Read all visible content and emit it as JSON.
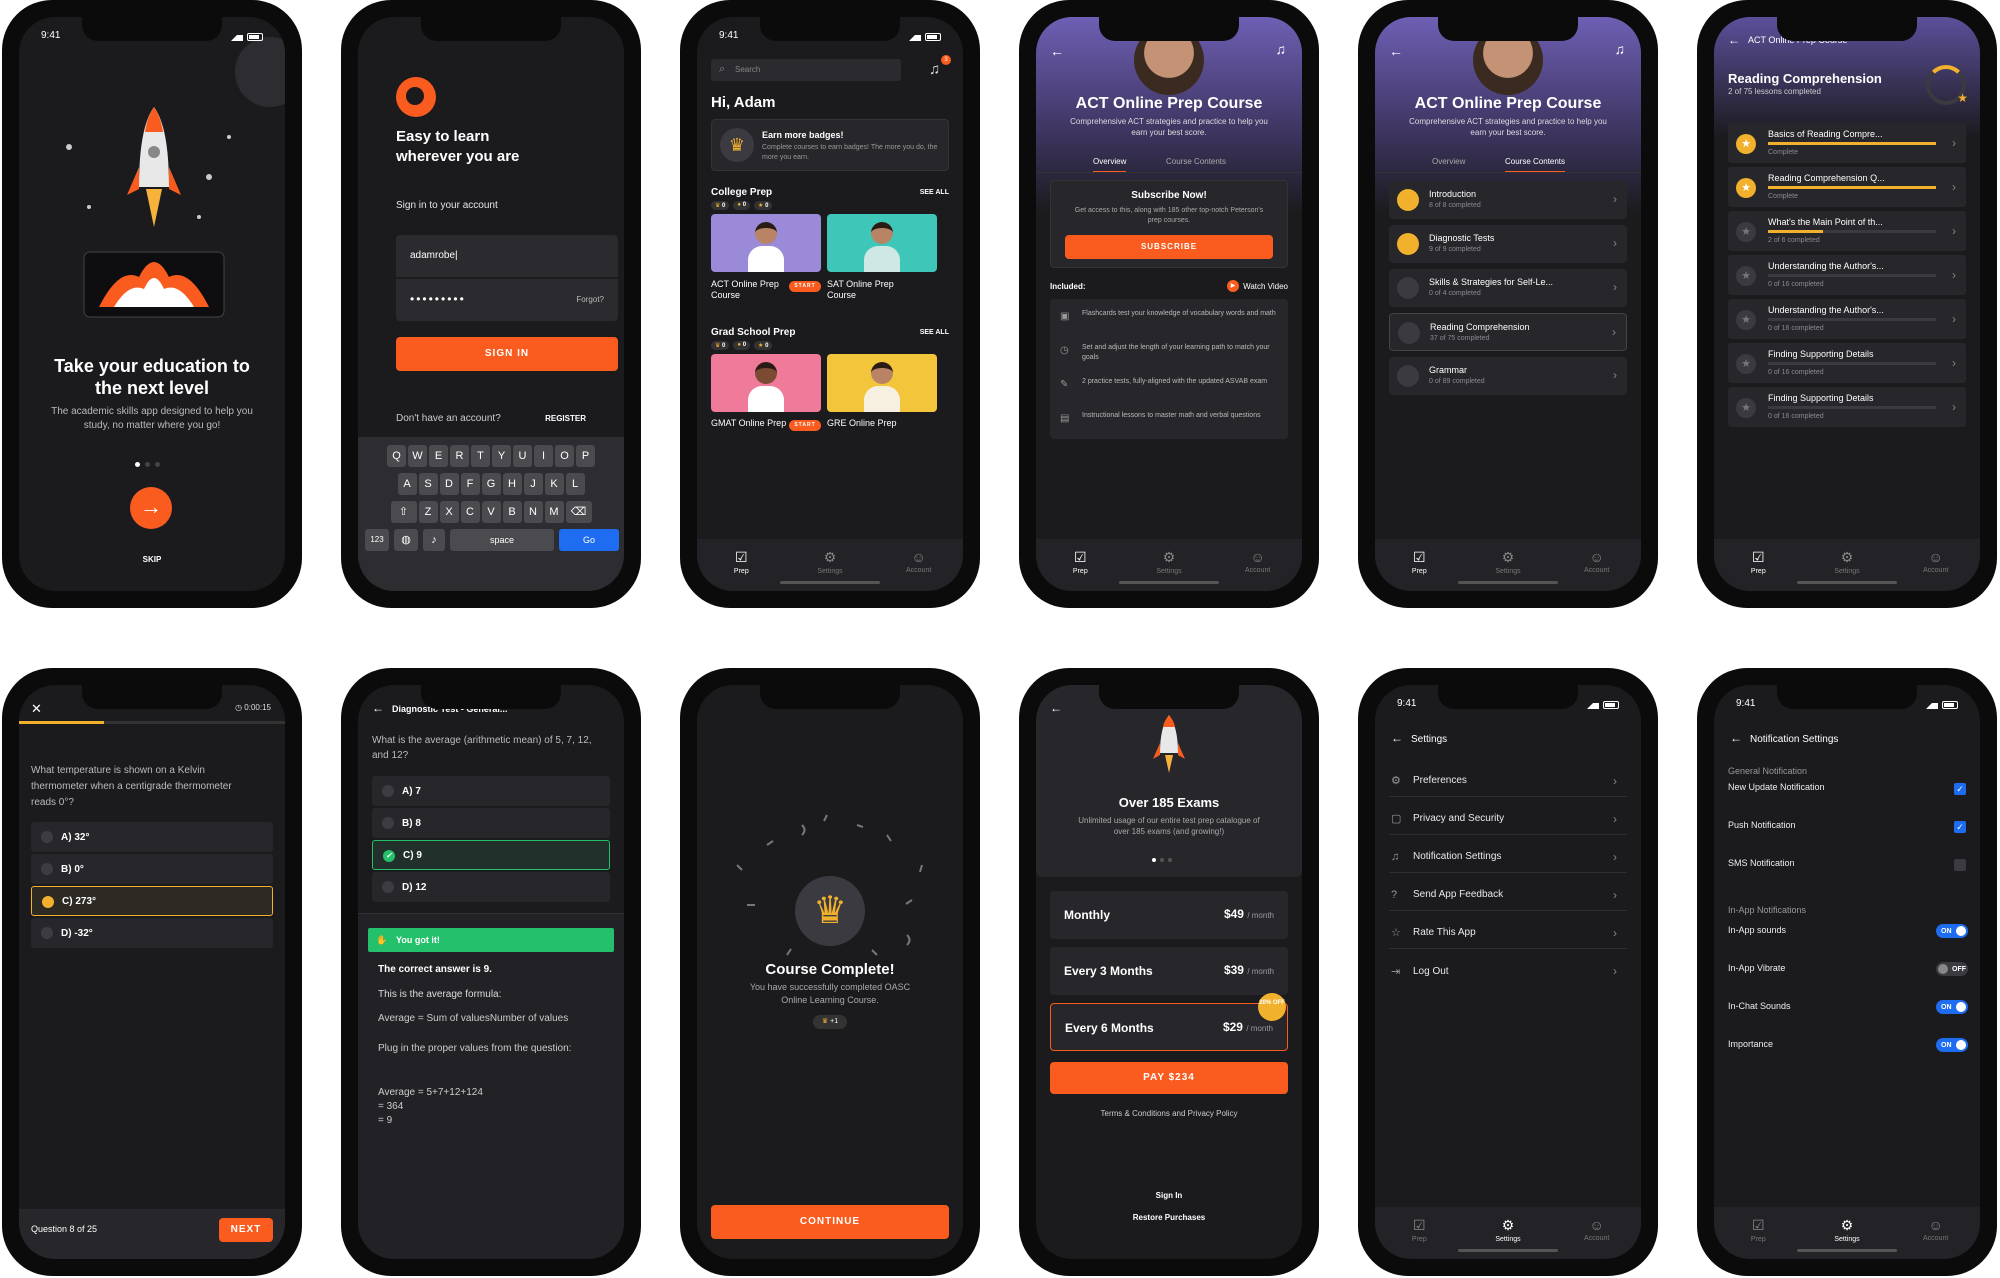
{
  "common": {
    "time": "9:41",
    "tab_prep": "Prep",
    "tab_settings": "Settings",
    "tab_account": "Account"
  },
  "s1": {
    "title": "Take your education to the next level",
    "subtitle": "The academic skills app designed to help you study, no matter where you go!",
    "skip": "SKIP"
  },
  "s2": {
    "headline": "Easy to learn wherever you are",
    "signin_prompt": "Sign in to your account",
    "username": "adamrobe|",
    "password": "•••••••••",
    "forgot": "Forgot?",
    "signin": "SIGN IN",
    "no_account": "Don't have an account?",
    "register": "REGISTER",
    "keys_row1": [
      "Q",
      "W",
      "E",
      "R",
      "T",
      "Y",
      "U",
      "I",
      "O",
      "P"
    ],
    "keys_row2": [
      "A",
      "S",
      "D",
      "F",
      "G",
      "H",
      "J",
      "K",
      "L"
    ],
    "keys_row3": [
      "Z",
      "X",
      "C",
      "V",
      "B",
      "N",
      "M"
    ],
    "k123": "123",
    "space": "space",
    "go": "Go"
  },
  "s3": {
    "search_placeholder": "Search",
    "notif_count": "3",
    "greeting": "Hi, Adam",
    "badge_title": "Earn more badges!",
    "badge_text": "Complete courses to earn badges! The more you do, the more you earn.",
    "college": "College Prep",
    "see_all": "SEE ALL",
    "grad": "Grad School Prep",
    "counts": [
      "0",
      "0",
      "0"
    ],
    "act": "ACT Online Prep Course",
    "sat": "SAT Online Prep Course",
    "start": "START",
    "gmat": "GMAT Online Prep",
    "gre": "GRE Online Prep"
  },
  "s4": {
    "title": "ACT Online Prep Course",
    "desc": "Comprehensive ACT strategies and practice to help you earn your best score.",
    "tab_overview": "Overview",
    "tab_contents": "Course Contents",
    "sub_title": "Subscribe Now!",
    "sub_text": "Get access to this, along with 185 other top-notch Peterson's prep courses.",
    "subscribe": "SUBSCRIBE",
    "included": "Included:",
    "watch": "Watch Video",
    "features": [
      "Flashcards test your knowledge of vocabulary words and math",
      "Set and adjust the length of your learning path to match your goals",
      "2 practice tests, fully-aligned with the updated ASVAB exam",
      "Instructional lessons to master math and verbal questions"
    ]
  },
  "s5": {
    "modules": [
      {
        "name": "Introduction",
        "sub": "8 of 8 completed"
      },
      {
        "name": "Diagnostic Tests",
        "sub": "9 of 9 completed"
      },
      {
        "name": "Skills & Strategies for Self-Le...",
        "sub": "0 of 4 completed"
      },
      {
        "name": "Reading Comprehension",
        "sub": "37 of 75 completed"
      },
      {
        "name": "Grammar",
        "sub": "0 of 89 completed"
      }
    ]
  },
  "s6": {
    "breadcrumb": "ACT Online Prep Course",
    "title": "Reading Comprehension",
    "sub": "2 of 75 lessons completed",
    "lessons": [
      {
        "t": "Basics of Reading Compre...",
        "s": "Complete",
        "p": 1.0
      },
      {
        "t": "Reading Comprehension Q...",
        "s": "Complete",
        "p": 1.0
      },
      {
        "t": "What's the Main Point of th...",
        "s": "2 of 6 completed",
        "p": 0.33
      },
      {
        "t": "Understanding the Author's...",
        "s": "0 of 16 completed",
        "p": 0
      },
      {
        "t": "Understanding the Author's...",
        "s": "0 of 16 completed",
        "p": 0
      },
      {
        "t": "Finding Supporting Details",
        "s": "0 of 16 completed",
        "p": 0
      },
      {
        "t": "Finding Supporting Details",
        "s": "0 of 16 completed",
        "p": 0
      }
    ]
  },
  "s7": {
    "timer": "0:00:15",
    "progress": 0.32,
    "question": "What temperature is shown on a Kelvin thermometer when a centigrade thermometer reads 0°?",
    "answers": [
      "A)  32°",
      "B)  0°",
      "C)  273°",
      "D)  -32°"
    ],
    "counter": "Question 8 of 25",
    "next": "NEXT"
  },
  "s8": {
    "title": "Diagnostic Test - General...",
    "question": "What is the average (arithmetic mean) of 5, 7, 12, and 12?",
    "answers": [
      "A)  7",
      "B)  8",
      "C)  9",
      "D)  12"
    ],
    "got_it": "You got it!",
    "correct": "The correct answer is 9.",
    "formula_intro": "This is the average formula:",
    "f1": "Average  =  Sum of valuesNumber of values",
    "f2": "Plug in the proper values from the question:",
    "f3a": "Average  =  5+7+12+124",
    "f3b": "=  364",
    "f3c": "=  9"
  },
  "s9": {
    "title": "Course Complete!",
    "text": "You have successfully completed OASC Online Learning Course.",
    "plus": "+1",
    "continue": "CONTINUE"
  },
  "s10": {
    "title": "Over 185 Exams",
    "text": "Unlimited usage of our entire test prep catalogue of over 185 exams (and growing!)",
    "plans": [
      {
        "name": "Monthly",
        "price": "$49",
        "per": "/ month"
      },
      {
        "name": "Every 3 Months",
        "price": "$39",
        "per": "/ month"
      },
      {
        "name": "Every 6 Months",
        "price": "$29",
        "per": "/ month"
      }
    ],
    "badge": "20% OFF",
    "pay": "PAY $234",
    "terms": "Terms & Conditions and Privacy Policy",
    "signin": "Sign In",
    "restore": "Restore Purchases"
  },
  "s11": {
    "title": "Settings",
    "items": [
      "Preferences",
      "Privacy and Security",
      "Notification Settings",
      "Send App Feedback",
      "Rate This App",
      "Log Out"
    ]
  },
  "s12": {
    "title": "Notification Settings",
    "general": "General Notification",
    "g_items": [
      "New Update Notification",
      "Push Notification",
      "SMS Notification"
    ],
    "inapp": "In-App Notifications",
    "a_items": [
      "In-App sounds",
      "In-App Vibrate",
      "In-Chat Sounds",
      "Importance"
    ],
    "on": "ON",
    "off": "OFF"
  },
  "colors": {
    "accent": "#fa5b1e",
    "blue": "#1e6cf0",
    "gold": "#f2b12d",
    "green": "#25c06b"
  }
}
